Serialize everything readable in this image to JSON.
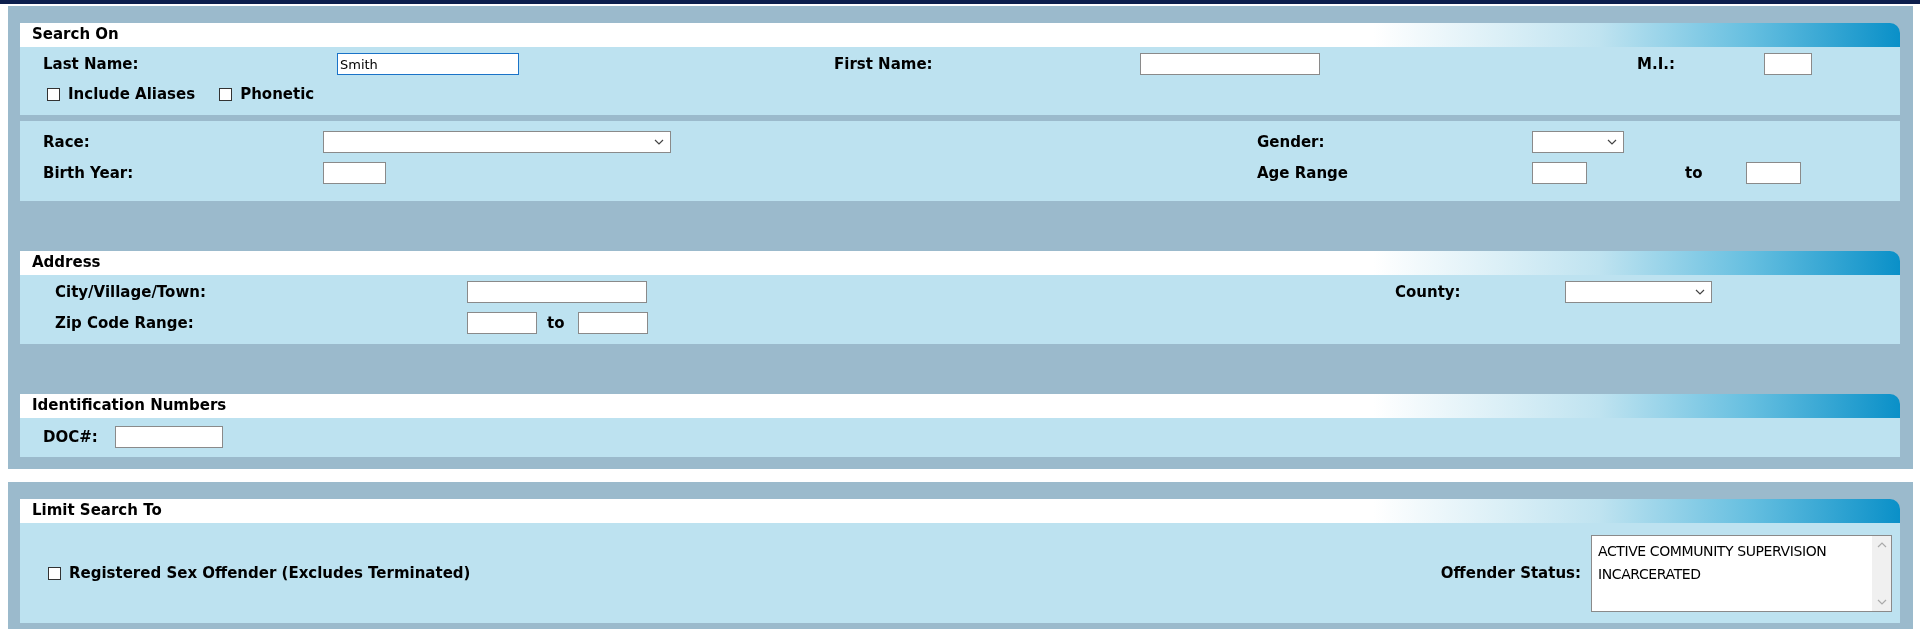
{
  "frames": [
    {
      "sections": [
        {
          "title": "Search On",
          "rows": [
            [
              {
                "kind": "label",
                "text": "Last Name:"
              },
              {
                "kind": "input",
                "value": "Smith",
                "focused": true
              },
              {
                "kind": "label",
                "text": "First Name:"
              },
              {
                "kind": "input",
                "focused": false
              },
              {
                "kind": "label",
                "text": "M.I.:"
              },
              {
                "kind": "input",
                "focused": false
              }
            ],
            [
              {
                "kind": "checkbox",
                "text": "Include Aliases",
                "checked": false
              },
              {
                "kind": "checkbox",
                "text": "Phonetic",
                "checked": false
              }
            ]
          ]
        },
        {
          "rows": [
            [
              {
                "kind": "label",
                "text": "Race:"
              },
              {
                "kind": "select"
              },
              {
                "kind": "label",
                "text": "Gender:"
              },
              {
                "kind": "select"
              }
            ],
            [
              {
                "kind": "label",
                "text": "Birth Year:"
              },
              {
                "kind": "input",
                "focused": false
              },
              {
                "kind": "label",
                "text": "Age Range"
              },
              {
                "kind": "input",
                "focused": false
              },
              {
                "kind": "label",
                "text": "to"
              },
              {
                "kind": "input",
                "focused": false
              }
            ]
          ]
        },
        {
          "title": "Address",
          "rows": [
            [
              {
                "kind": "label",
                "text": "City/Village/Town:"
              },
              {
                "kind": "input",
                "focused": false
              },
              {
                "kind": "label",
                "text": "County:"
              },
              {
                "kind": "select"
              }
            ],
            [
              {
                "kind": "label",
                "text": "Zip Code Range:"
              },
              {
                "kind": "input",
                "focused": false
              },
              {
                "kind": "label",
                "text": "to"
              },
              {
                "kind": "input",
                "focused": false
              }
            ]
          ]
        },
        {
          "title": "Identification Numbers",
          "rows": [
            [
              {
                "kind": "label",
                "text": "DOC#:"
              },
              {
                "kind": "input",
                "focused": false
              }
            ]
          ]
        }
      ]
    },
    {
      "sections": [
        {
          "title": "Limit Search To",
          "rows": [
            [
              {
                "kind": "checkbox",
                "text": "Registered Sex Offender (Excludes Terminated)",
                "checked": false
              },
              {
                "kind": "label",
                "text": "Offender Status:"
              },
              {
                "kind": "listbox",
                "options": [
                  "ACTIVE COMMUNITY SUPERVISION",
                  "INCARCERATED"
                ]
              }
            ]
          ]
        }
      ]
    }
  ]
}
